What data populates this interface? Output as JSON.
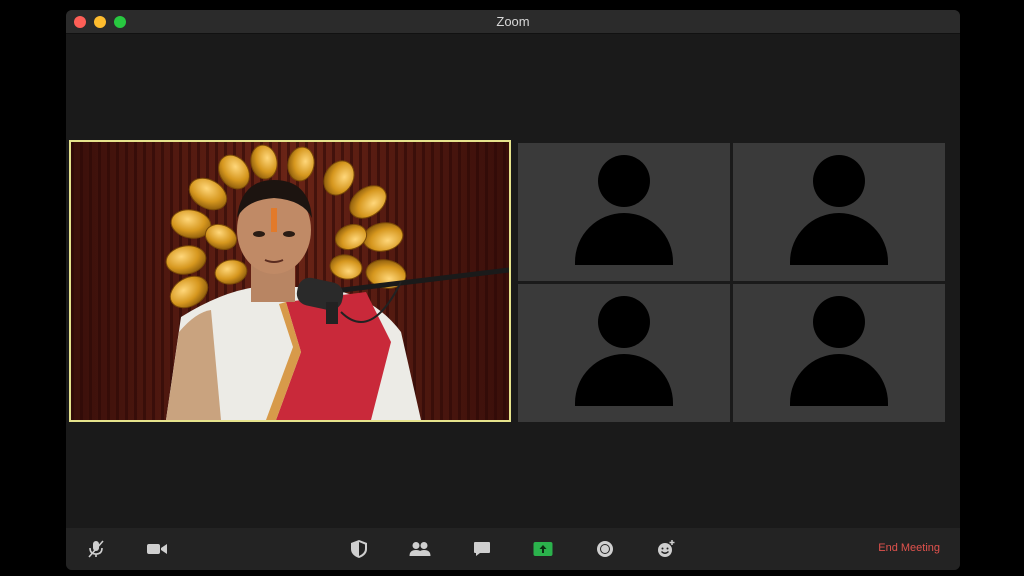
{
  "window": {
    "title": "Zoom"
  },
  "toolbar": {
    "icons": [
      "mute-mic-icon",
      "camera-icon",
      "security-shield-icon",
      "participants-icon",
      "chat-icon",
      "share-screen-icon",
      "record-icon",
      "reactions-icon"
    ],
    "end_label": "End Meeting",
    "end_color": "#e0524d",
    "share_color": "#2bb24c"
  },
  "speaker": {
    "highlight_color": "#e6e38c"
  },
  "participants": [
    {
      "avatar": "generic-person-icon"
    },
    {
      "avatar": "generic-person-icon"
    },
    {
      "avatar": "generic-person-icon"
    },
    {
      "avatar": "generic-person-icon"
    }
  ]
}
